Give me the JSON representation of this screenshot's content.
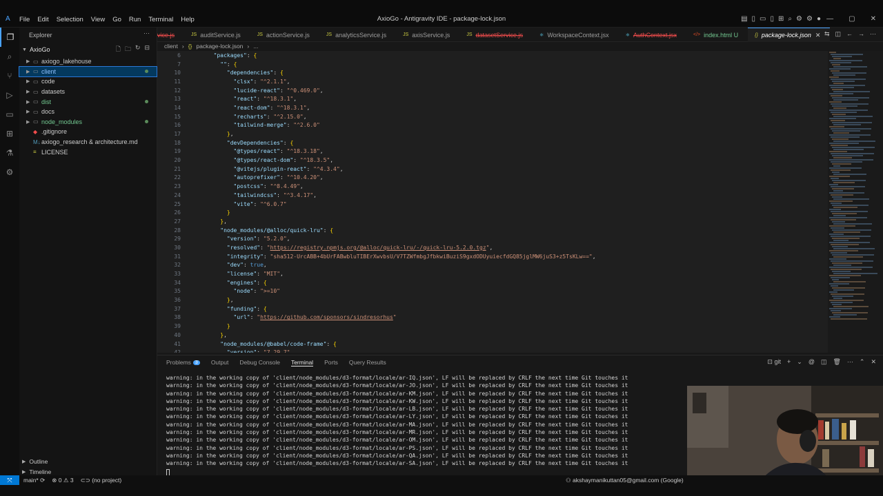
{
  "app": {
    "title": "AxioGo - Antigravity IDE - package-lock.json",
    "menu": [
      "File",
      "Edit",
      "Selection",
      "View",
      "Go",
      "Run",
      "Terminal",
      "Help"
    ]
  },
  "explorer": {
    "header": "Explorer",
    "root": "AxioGo",
    "items": [
      {
        "label": "axiogo_lakehouse",
        "type": "folder"
      },
      {
        "label": "client",
        "type": "folder"
      },
      {
        "label": "code",
        "type": "folder"
      },
      {
        "label": "datasets",
        "type": "folder"
      },
      {
        "label": "dist",
        "type": "folder"
      },
      {
        "label": "docs",
        "type": "folder"
      },
      {
        "label": "node_modules",
        "type": "folder"
      },
      {
        "label": ".gitignore",
        "type": "file"
      },
      {
        "label": "axiogo_research & architecture.md",
        "type": "file"
      },
      {
        "label": "LICENSE",
        "type": "file"
      }
    ],
    "outline": "Outline",
    "timeline": "Timeline"
  },
  "tabs": [
    {
      "label": "vice.js",
      "state": "error"
    },
    {
      "label": "auditService.js",
      "state": "normal"
    },
    {
      "label": "actionService.js",
      "state": "normal"
    },
    {
      "label": "analyticsService.js",
      "state": "normal"
    },
    {
      "label": "axisService.js",
      "state": "normal"
    },
    {
      "label": "datasetService.js",
      "state": "error"
    },
    {
      "label": "WorkspaceContext.jsx",
      "state": "normal"
    },
    {
      "label": "AuthContext.jsx",
      "state": "error"
    },
    {
      "label": "index.html U",
      "state": "git"
    },
    {
      "label": "package-lock.json",
      "state": "active"
    }
  ],
  "breadcrumb": {
    "folder": "client",
    "file": "package-lock.json",
    "more": "..."
  },
  "editor": {
    "lines": [
      {
        "n": "6",
        "t": "  \"packages\": {"
      },
      {
        "n": "7",
        "t": "    \"\": {"
      },
      {
        "n": "10",
        "t": "      \"dependencies\": {"
      },
      {
        "n": "11",
        "t": "        \"clsx\": \"^2.1.1\","
      },
      {
        "n": "12",
        "t": "        \"lucide-react\": \"^0.469.0\","
      },
      {
        "n": "13",
        "t": "        \"react\": \"^18.3.1\","
      },
      {
        "n": "14",
        "t": "        \"react-dom\": \"^18.3.1\","
      },
      {
        "n": "15",
        "t": "        \"recharts\": \"^2.15.0\","
      },
      {
        "n": "16",
        "t": "        \"tailwind-merge\": \"^2.6.0\""
      },
      {
        "n": "17",
        "t": "      },"
      },
      {
        "n": "18",
        "t": "      \"devDependencies\": {"
      },
      {
        "n": "19",
        "t": "        \"@types/react\": \"^18.3.18\","
      },
      {
        "n": "20",
        "t": "        \"@types/react-dom\": \"^18.3.5\","
      },
      {
        "n": "21",
        "t": "        \"@vitejs/plugin-react\": \"^4.3.4\","
      },
      {
        "n": "22",
        "t": "        \"autoprefixer\": \"^10.4.20\","
      },
      {
        "n": "23",
        "t": "        \"postcss\": \"^8.4.49\","
      },
      {
        "n": "24",
        "t": "        \"tailwindcss\": \"^3.4.17\","
      },
      {
        "n": "25",
        "t": "        \"vite\": \"^6.0.7\""
      },
      {
        "n": "26",
        "t": "      }"
      },
      {
        "n": "27",
        "t": "    },"
      },
      {
        "n": "28",
        "t": "    \"node_modules/@alloc/quick-lru\": {"
      },
      {
        "n": "29",
        "t": "      \"version\": \"5.2.0\","
      },
      {
        "n": "30",
        "t": "      \"resolved\": \"https://registry.npmjs.org/@alloc/quick-lru/-/quick-lru-5.2.0.tgz\","
      },
      {
        "n": "31",
        "t": "      \"integrity\": \"sha512-UrcABB+4bUrFABwbluTIBErXwvbsU/V7TZWfmbgJfbkwiBuziS9gxdODUyuiecfdGQ85jglMW6juS3+z5TsKLw==\","
      },
      {
        "n": "32",
        "t": "      \"dev\": true,"
      },
      {
        "n": "33",
        "t": "      \"license\": \"MIT\","
      },
      {
        "n": "34",
        "t": "      \"engines\": {"
      },
      {
        "n": "35",
        "t": "        \"node\": \">=10\""
      },
      {
        "n": "36",
        "t": "      },"
      },
      {
        "n": "37",
        "t": "      \"funding\": {"
      },
      {
        "n": "38",
        "t": "        \"url\": \"https://github.com/sponsors/sindresorhus\""
      },
      {
        "n": "39",
        "t": "      }"
      },
      {
        "n": "40",
        "t": "    },"
      },
      {
        "n": "41",
        "t": "    \"node_modules/@babel/code-frame\": {"
      },
      {
        "n": "42",
        "t": "      \"version\": \"7.29.7\","
      }
    ]
  },
  "panel": {
    "tabs": [
      "Problems",
      "Output",
      "Debug Console",
      "Terminal",
      "Ports",
      "Query Results"
    ],
    "problems_count": "3",
    "active_tab": "Terminal",
    "shell": "git",
    "terminal_lines": [
      "warning: in the working copy of 'client/node_modules/d3-format/locale/ar-IQ.json', LF will be replaced by CRLF the next time Git touches it",
      "warning: in the working copy of 'client/node_modules/d3-format/locale/ar-JO.json', LF will be replaced by CRLF the next time Git touches it",
      "warning: in the working copy of 'client/node_modules/d3-format/locale/ar-KM.json', LF will be replaced by CRLF the next time Git touches it",
      "warning: in the working copy of 'client/node_modules/d3-format/locale/ar-KW.json', LF will be replaced by CRLF the next time Git touches it",
      "warning: in the working copy of 'client/node_modules/d3-format/locale/ar-LB.json', LF will be replaced by CRLF the next time Git touches it",
      "warning: in the working copy of 'client/node_modules/d3-format/locale/ar-LY.json', LF will be replaced by CRLF the next time Git touches it",
      "warning: in the working copy of 'client/node_modules/d3-format/locale/ar-MA.json', LF will be replaced by CRLF the next time Git touches it",
      "warning: in the working copy of 'client/node_modules/d3-format/locale/ar-MR.json', LF will be replaced by CRLF the next time Git touches it",
      "warning: in the working copy of 'client/node_modules/d3-format/locale/ar-OM.json', LF will be replaced by CRLF the next time Git touches it",
      "warning: in the working copy of 'client/node_modules/d3-format/locale/ar-PS.json', LF will be replaced by CRLF the next time Git touches it",
      "warning: in the working copy of 'client/node_modules/d3-format/locale/ar-QA.json', LF will be replaced by CRLF the next time Git touches it",
      "warning: in the working copy of 'client/node_modules/d3-format/locale/ar-SA.json', LF will be replaced by CRLF the next time Git touches it"
    ]
  },
  "status": {
    "branch": "main*",
    "errors": "0",
    "warnings": "3",
    "project": "(no project)",
    "account": "akshaymanikuttan05@gmail.com (Google)"
  }
}
